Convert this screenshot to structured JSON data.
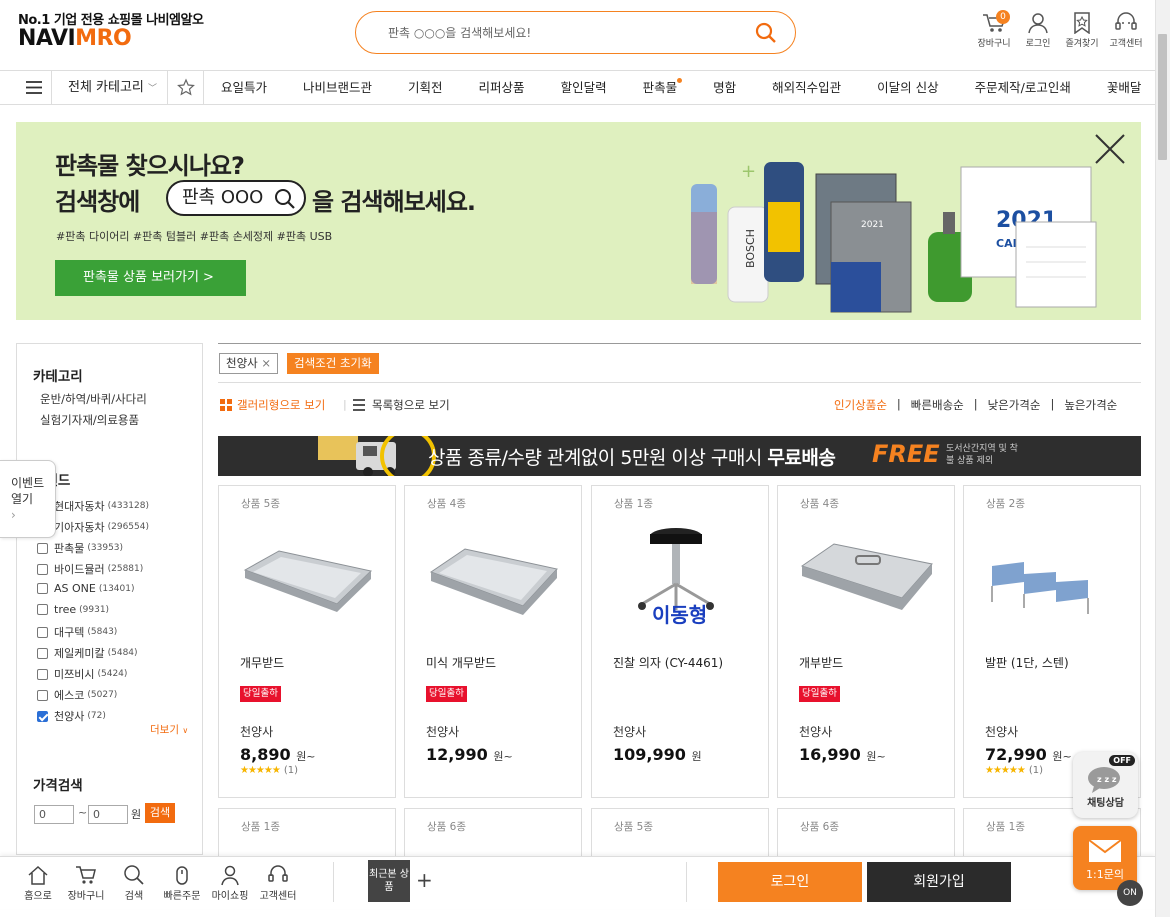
{
  "header": {
    "tagline": "No.1 기업 전용 쇼핑몰 나비엠알오",
    "logo_navi": "NAVI",
    "logo_mro": "MRO",
    "search_placeholder": "판촉 ○○○을 검색해보세요!",
    "cart_count": "0",
    "icons": [
      {
        "label": "장바구니",
        "icon": "cart-icon"
      },
      {
        "label": "로그인",
        "icon": "user-icon"
      },
      {
        "label": "즐겨찾기",
        "icon": "star-icon"
      },
      {
        "label": "고객센터",
        "icon": "headset-icon"
      }
    ]
  },
  "nav": {
    "all_category": "전체 카테고리",
    "items": [
      "요일특가",
      "나비브랜드관",
      "기획전",
      "리퍼상품",
      "할인달력",
      "판촉물",
      "명함",
      "해외직수입관",
      "이달의 신상",
      "주문제작/로고인쇄",
      "꽃배달"
    ]
  },
  "banner": {
    "line1": "판촉물 찾으시나요?",
    "line2_a": "검색창에",
    "pill": "판촉 OOO",
    "line2_b": "을 검색해보세요.",
    "tags": "#판촉 다이어리 #판촉 텀블러 #판촉 손세정제 #판촉 USB",
    "button": "판촉물 상품 보러가기  >",
    "calendar_year": "2021",
    "calendar_word": "CALEN"
  },
  "sidebar": {
    "category_title": "카테고리",
    "categories": [
      "운반/하역/바퀴/사다리",
      "실험기자재/의료용품"
    ],
    "brand_title": "브랜드",
    "brands": [
      {
        "name": "현대자동차",
        "count": "(433128)",
        "checked": false
      },
      {
        "name": "기아자동차",
        "count": "(296554)",
        "checked": false
      },
      {
        "name": "판촉물",
        "count": "(33953)",
        "checked": false
      },
      {
        "name": "바이드뮬러",
        "count": "(25881)",
        "checked": false
      },
      {
        "name": "AS ONE",
        "count": "(13401)",
        "checked": false
      },
      {
        "name": "tree",
        "count": "(9931)",
        "checked": false
      },
      {
        "name": "대구텍",
        "count": "(5843)",
        "checked": false
      },
      {
        "name": "제일케미칼",
        "count": "(5484)",
        "checked": false
      },
      {
        "name": "미쯔비시",
        "count": "(5424)",
        "checked": false
      },
      {
        "name": "에스코",
        "count": "(5027)",
        "checked": false
      },
      {
        "name": "천양사",
        "count": "(72)",
        "checked": true
      }
    ],
    "more": "더보기",
    "price_title": "가격검색",
    "price_min": "0",
    "price_max": "0",
    "price_unit": "원",
    "price_button": "검색",
    "event_tab": "이벤트 열기"
  },
  "filters": {
    "active_tag": "천양사",
    "reset": "검색조건 초기화",
    "view_gallery": "갤러리형으로 보기",
    "view_list": "목록형으로 보기",
    "sorts": [
      "인기상품순",
      "빠른배송순",
      "낮은가격순",
      "높은가격순"
    ]
  },
  "shipping": {
    "text": "상품 종류/수량 관계없이 5만원 이상 구매시 ",
    "bold": "무료배송",
    "free": "FREE",
    "note": "도서산간지역 및 착불 상품 제외"
  },
  "products": [
    {
      "count": "상품 5종",
      "name": "개무받드",
      "tag": "당일출하",
      "brand": "천양사",
      "price": "8,890",
      "unit": "원~",
      "rating": "★★★★★",
      "reviews": "(1)"
    },
    {
      "count": "상품 4종",
      "name": "미식 개무받드",
      "tag": "당일출하",
      "brand": "천양사",
      "price": "12,990",
      "unit": "원~",
      "rating": "",
      "reviews": ""
    },
    {
      "count": "상품 1종",
      "name": "진찰 의자 (CY-4461)",
      "tag": "",
      "brand": "천양사",
      "price": "109,990",
      "unit": "원",
      "rating": "",
      "reviews": "",
      "img_text": "이동형"
    },
    {
      "count": "상품 4종",
      "name": "개부받드",
      "tag": "당일출하",
      "brand": "천양사",
      "price": "16,990",
      "unit": "원~",
      "rating": "",
      "reviews": ""
    },
    {
      "count": "상품 2종",
      "name": "발판 (1단, 스텐)",
      "tag": "",
      "brand": "천양사",
      "price": "72,990",
      "unit": "원~",
      "rating": "★★★★★",
      "reviews": "(1)"
    }
  ],
  "products_row2": [
    "상품 1종",
    "상품 6종",
    "상품 5종",
    "상품 6종",
    "상품 1종"
  ],
  "bottom": {
    "items": [
      {
        "label": "홈으로",
        "icon": "home-icon"
      },
      {
        "label": "장바구니",
        "icon": "cart-icon"
      },
      {
        "label": "검색",
        "icon": "search-icon"
      },
      {
        "label": "빠른주문",
        "icon": "mouse-icon"
      },
      {
        "label": "마이쇼핑",
        "icon": "user-icon"
      },
      {
        "label": "고객센터",
        "icon": "headset-icon"
      }
    ],
    "recent": "최근본 상품",
    "login": "로그인",
    "join": "회원가입"
  },
  "floating": {
    "chat_off": "OFF",
    "chat": "채팅상담",
    "inquiry": "1:1문의",
    "on": "ON"
  }
}
